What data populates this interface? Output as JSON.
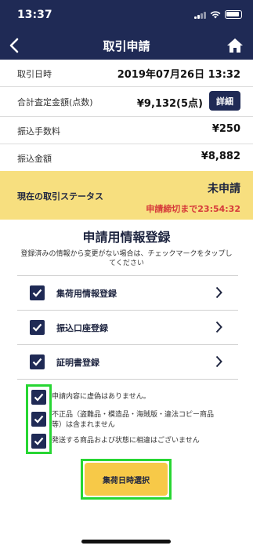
{
  "status_bar": {
    "time": "13:37"
  },
  "nav": {
    "title": "取引申請"
  },
  "info": [
    {
      "label": "取引日時",
      "value": "2019年07月26日 13:32"
    },
    {
      "label": "合計査定金額(点数)",
      "value": "¥9,132(5点)",
      "button": "詳細"
    },
    {
      "label": "振込手数料",
      "value": "¥250"
    },
    {
      "label": "振込金額",
      "value": "¥8,882"
    }
  ],
  "status_panel": {
    "label": "現在の取引ステータス",
    "value": "未申請",
    "deadline": "申請締切まで23:54:32"
  },
  "registration": {
    "title": "申請用情報登録",
    "description": "登録済みの情報から変更がない場合は、チェックマークをタップしてください",
    "items": [
      {
        "label": "集荷用情報登録"
      },
      {
        "label": "振込口座登録"
      },
      {
        "label": "証明書登録"
      }
    ]
  },
  "agreements": [
    {
      "text": "申請内容に虚偽はありません。"
    },
    {
      "text": "不正品（盗難品・模造品・海賊版・違法コピー商品等）は含まれません"
    },
    {
      "text": "発送する商品および状態に相違はございません"
    }
  ],
  "submit": {
    "label": "集荷日時選択"
  },
  "colors": {
    "navy": "#1f2a55",
    "yellow_panel": "#f7df7f",
    "button_yellow": "#f7c948",
    "deadline_red": "#d63a3a",
    "highlight_green": "#27d633"
  }
}
